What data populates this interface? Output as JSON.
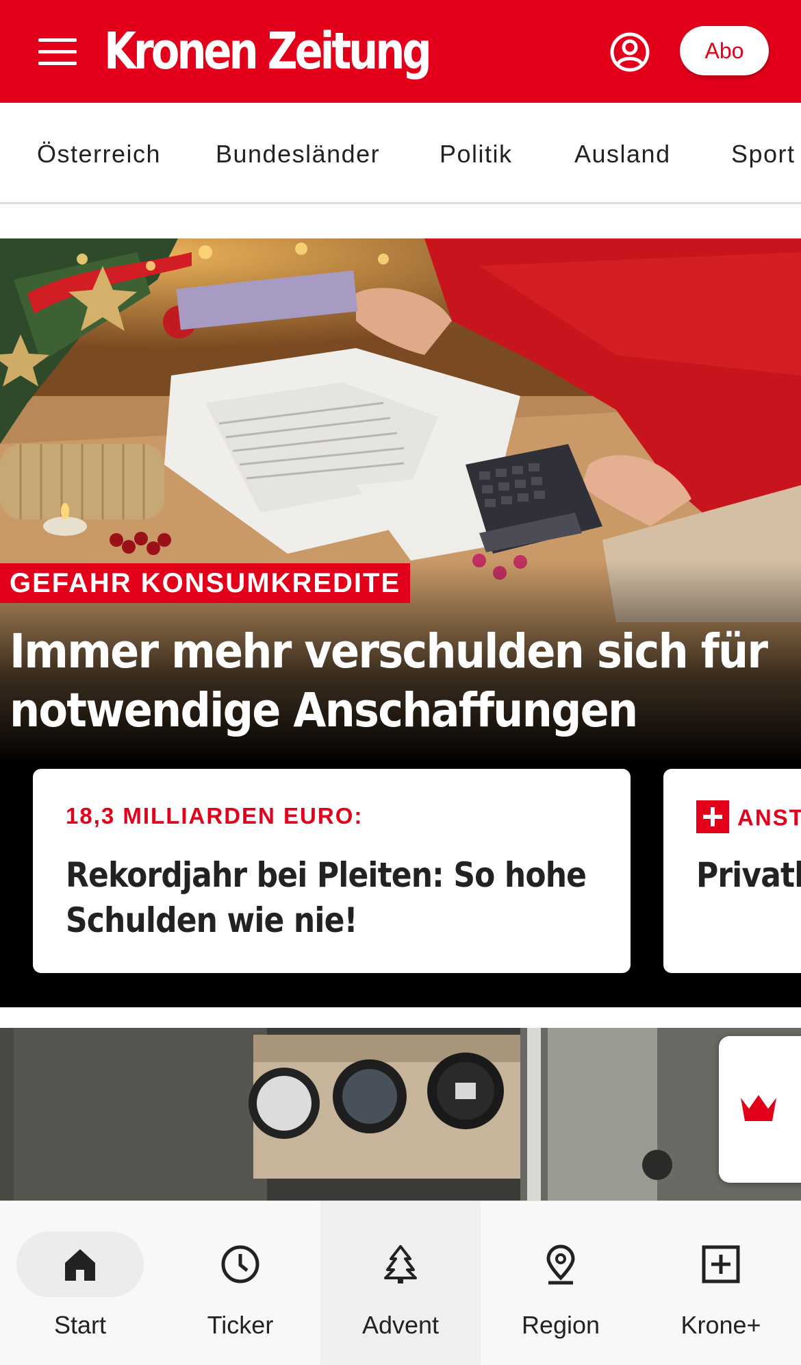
{
  "header": {
    "logo_text": "Kronen Zeitung",
    "abo_label": "Abo",
    "brand_color": "#e2001a"
  },
  "categories": [
    "Österreich",
    "Bundesländer",
    "Politik",
    "Ausland",
    "Sport"
  ],
  "hero": {
    "kicker": "GEFAHR KONSUMKREDITE",
    "title": "Immer mehr verschulden sich für notwendige Anschaffungen"
  },
  "cards": [
    {
      "kicker": "18,3 MILLIARDEN EURO:",
      "title": "Rekordjahr bei Pleiten: So hohe Schulden wie nie!"
    },
    {
      "kicker": "ANST",
      "title": "Privatl man di"
    }
  ],
  "bottom_nav": {
    "items": [
      {
        "label": "Start",
        "icon": "home-icon"
      },
      {
        "label": "Ticker",
        "icon": "clock-icon"
      },
      {
        "label": "Advent",
        "icon": "tree-icon"
      },
      {
        "label": "Region",
        "icon": "location-pin-icon"
      },
      {
        "label": "Krone+",
        "icon": "plus-square-icon"
      }
    ]
  }
}
